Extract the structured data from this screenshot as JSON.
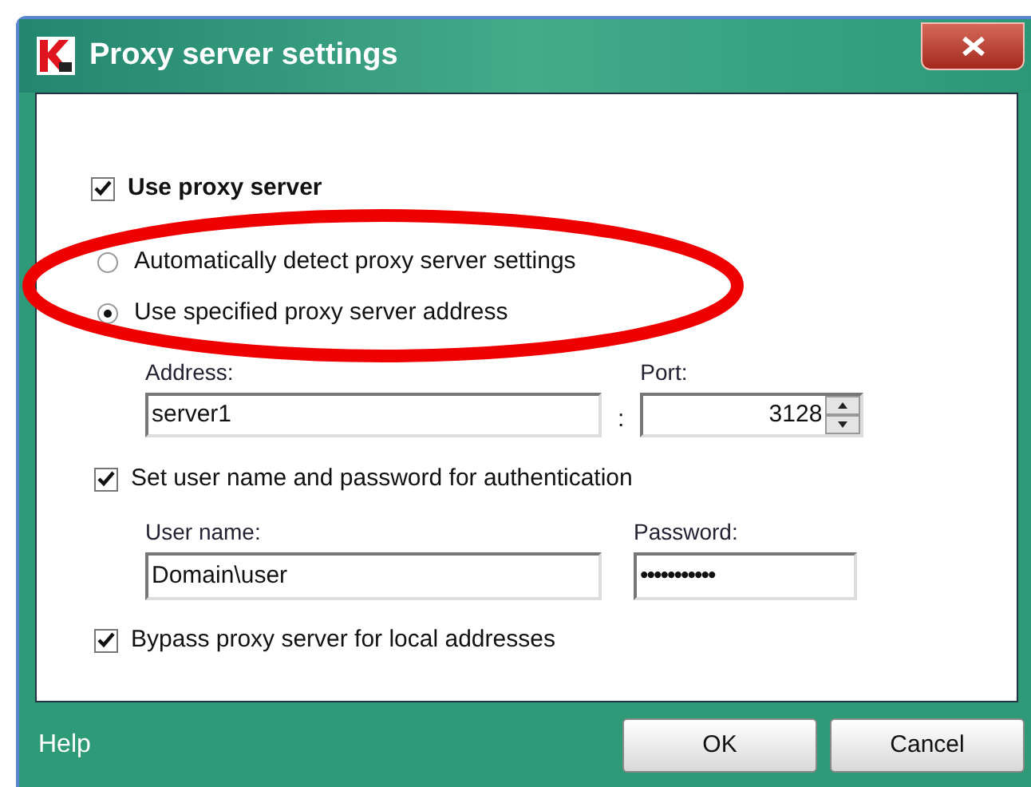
{
  "window": {
    "title": "Proxy server settings"
  },
  "use_proxy": {
    "label": "Use proxy server",
    "checked": true
  },
  "mode_options": [
    {
      "label": "Automatically detect proxy server settings",
      "selected": false
    },
    {
      "label": "Use specified proxy server address",
      "selected": true
    }
  ],
  "address": {
    "label": "Address:",
    "value": "server1"
  },
  "separator": ":",
  "port": {
    "label": "Port:",
    "value": "3128"
  },
  "authentication": {
    "label": "Set user name and password for authentication",
    "checked": true
  },
  "user_name": {
    "label": "User name:",
    "value": "Domain\\user"
  },
  "password": {
    "label": "Password:",
    "value": "•••••••••••"
  },
  "bypass_local": {
    "label": "Bypass proxy server for local addresses",
    "checked": true
  },
  "footer": {
    "help": "Help",
    "buttons": [
      "OK",
      "Cancel"
    ]
  }
}
